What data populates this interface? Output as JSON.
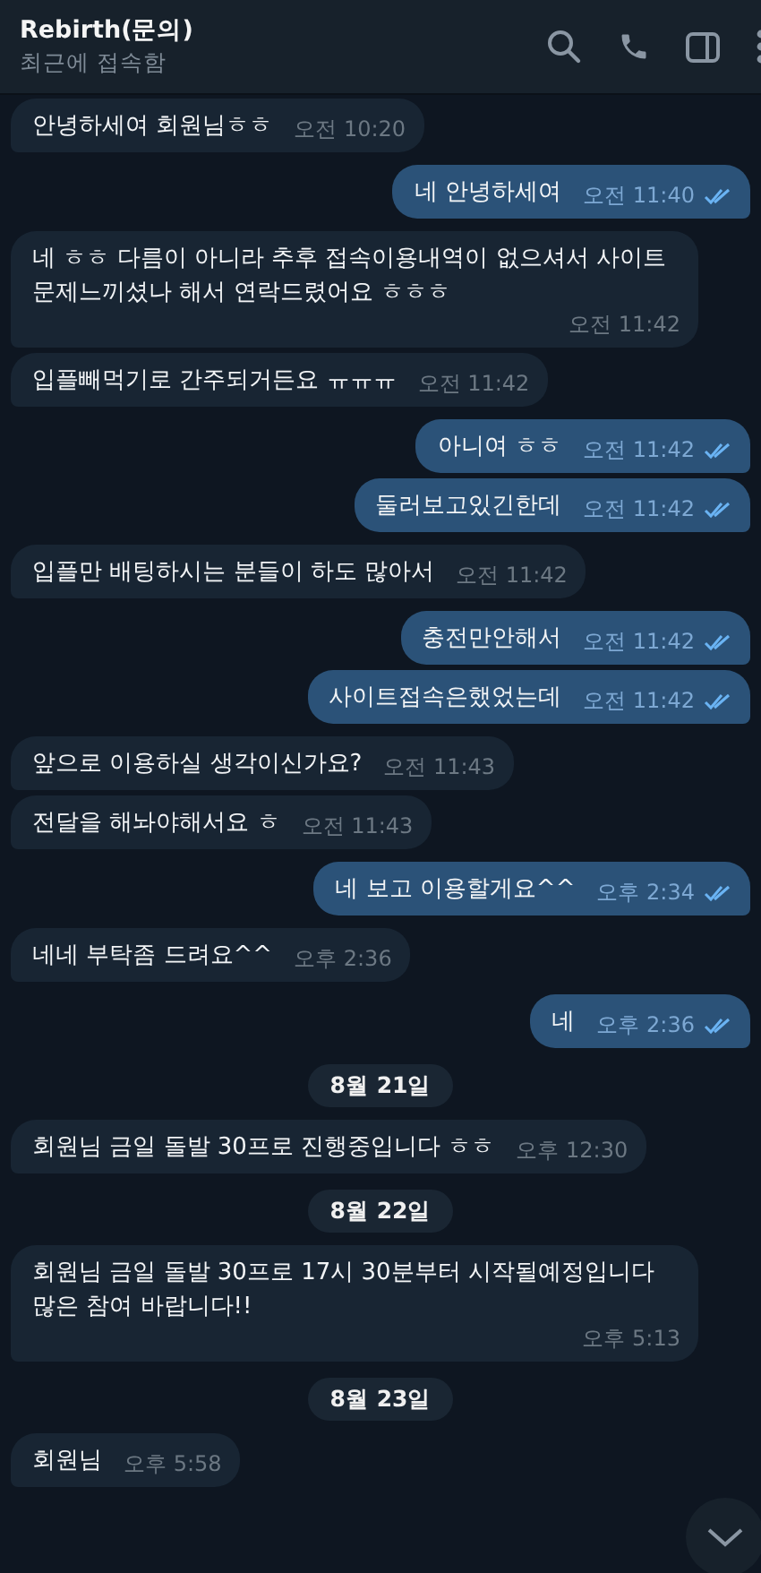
{
  "header": {
    "title": "Rebirth(문의)",
    "status": "최근에 접속함"
  },
  "messages": [
    {
      "kind": "in",
      "text": "안녕하세여 회원님ㅎㅎ",
      "time": "오전 10:20"
    },
    {
      "kind": "out",
      "text": "네 안녕하세여",
      "time": "오전 11:40",
      "read": true
    },
    {
      "kind": "in",
      "text": "네 ㅎㅎ 다름이 아니라 추후 접속이용내역이 없으셔서 사이트 문제느끼셨나 해서 연락드렸어요 ㅎㅎㅎ",
      "time": "오전 11:42"
    },
    {
      "kind": "in",
      "text": "입플빼먹기로 간주되거든요 ㅠㅠㅠ",
      "time": "오전 11:42"
    },
    {
      "kind": "out",
      "text": "아니여 ㅎㅎ",
      "time": "오전 11:42",
      "read": true
    },
    {
      "kind": "out",
      "text": "둘러보고있긴한데",
      "time": "오전 11:42",
      "read": true
    },
    {
      "kind": "in",
      "text": "입플만 배팅하시는 분들이 하도 많아서",
      "time": "오전 11:42"
    },
    {
      "kind": "out",
      "text": "충전만안해서",
      "time": "오전 11:42",
      "read": true
    },
    {
      "kind": "out",
      "text": "사이트접속은했었는데",
      "time": "오전 11:42",
      "read": true
    },
    {
      "kind": "in",
      "text": "앞으로 이용하실 생각이신가요?",
      "time": "오전 11:43"
    },
    {
      "kind": "in",
      "text": "전달을 해놔야해서요 ㅎ",
      "time": "오전 11:43"
    },
    {
      "kind": "out",
      "text": "네 보고 이용할게요^^",
      "time": "오후 2:34",
      "read": true
    },
    {
      "kind": "in",
      "text": "네네 부탁좀 드려요^^",
      "time": "오후 2:36"
    },
    {
      "kind": "out",
      "text": "네",
      "time": "오후 2:36",
      "read": true
    },
    {
      "kind": "date",
      "text": "8월 21일"
    },
    {
      "kind": "in",
      "text": "회원님 금일 돌발 30프로 진행중입니다 ㅎㅎ",
      "time": "오후 12:30"
    },
    {
      "kind": "date",
      "text": "8월 22일"
    },
    {
      "kind": "in",
      "text": "회원님 금일 돌발 30프로 17시 30분부터 시작될예정입니다 많은 참여 바랍니다!!",
      "time": "오후 5:13"
    },
    {
      "kind": "date",
      "text": "8월 23일"
    },
    {
      "kind": "in",
      "text": "회원님",
      "time": "오후 5:58"
    }
  ]
}
